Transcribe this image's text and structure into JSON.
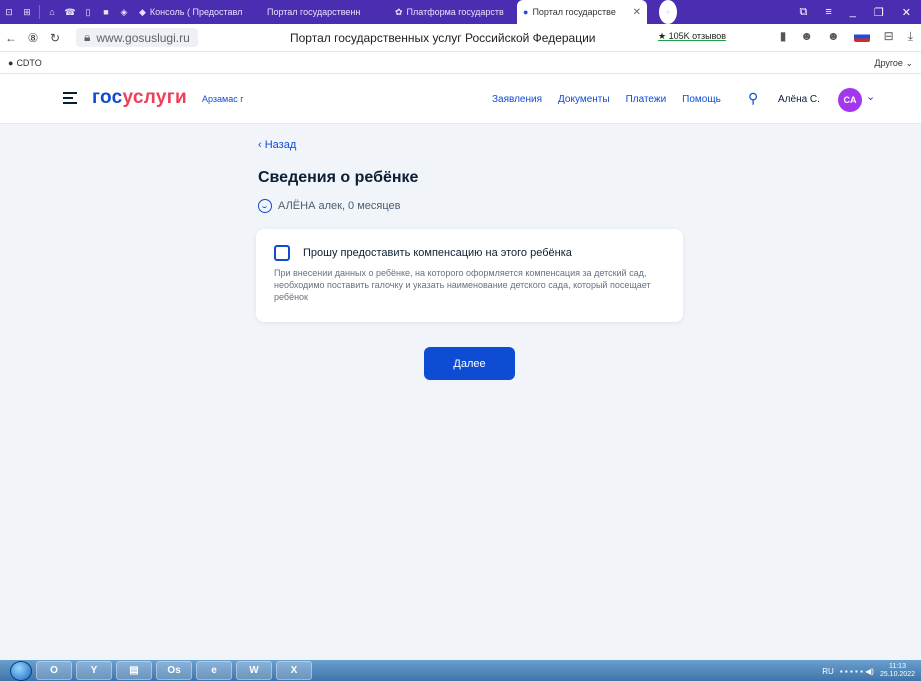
{
  "browser": {
    "tabs": [
      {
        "label": "Консоль ( Предоставл"
      },
      {
        "label": "Портал государственн"
      },
      {
        "label": "Платформа государств"
      },
      {
        "label": "Портал государстве"
      }
    ],
    "url": "www.gosuslugi.ru",
    "page_title": "Портал государственных услуг Российской Федерации",
    "reviews": "★ 105K отзывов",
    "bookmarks": [
      "СDTO"
    ],
    "bookmarks_other": "Другое"
  },
  "site": {
    "logo_a": "гос",
    "logo_b": "услуги",
    "city": "Арзамас г",
    "menu": [
      "Заявления",
      "Документы",
      "Платежи",
      "Помощь"
    ],
    "user_name": "Алёна С.",
    "avatar_initials": "CA"
  },
  "main": {
    "back": "Назад",
    "title": "Сведения о ребёнке",
    "child": "АЛЁНА алек, 0 месяцев",
    "checkbox_label": "Прошу предоставить компенсацию на этого ребёнка",
    "hint": "При внесении данных о ребёнке, на которого оформляется компенсация за детский сад, необходимо поставить галочку и указать наименование детского сада, который посещает ребёнок",
    "next_button": "Далее"
  },
  "taskbar": {
    "lang": "RU",
    "time": "11:13",
    "date": "25.10.2022"
  },
  "colors": {
    "brand_blue": "#0d4cd3",
    "brand_red": "#ee3f58",
    "avatar": "#a237ec"
  }
}
